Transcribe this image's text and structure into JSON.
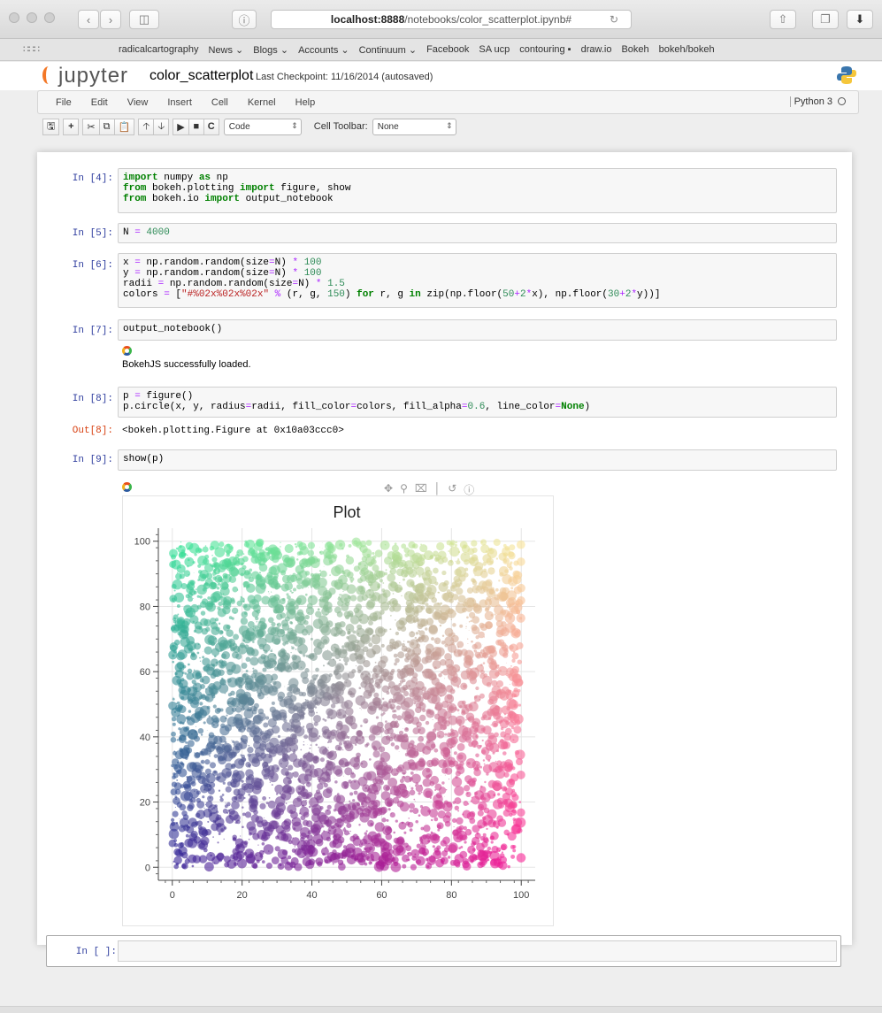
{
  "browser": {
    "url_host": "localhost:8888",
    "url_path": "/notebooks/color_scatterplot.ipynb#",
    "bookmarks": [
      "radicalcartography",
      "News ⌄",
      "Blogs ⌄",
      "Accounts ⌄",
      "Continuum ⌄",
      "Facebook",
      "SA ucp",
      "contouring ▪",
      "draw.io",
      "Bokeh",
      "bokeh/bokeh"
    ]
  },
  "jupyter": {
    "logo": "jupyter",
    "notebook_name": "color_scatterplot",
    "checkpoint": "Last Checkpoint: 11/16/2014 (autosaved)",
    "kernel": "Python 3",
    "menu": [
      "File",
      "Edit",
      "View",
      "Insert",
      "Cell",
      "Kernel",
      "Help"
    ],
    "cell_type": "Code",
    "cell_toolbar_label": "Cell Toolbar:",
    "cell_toolbar_value": "None"
  },
  "cells": {
    "c4": {
      "prompt": "In [4]:"
    },
    "c5": {
      "prompt": "In [5]:"
    },
    "c6": {
      "prompt": "In [6]:"
    },
    "c7": {
      "prompt": "In [7]:",
      "output": "BokehJS successfully loaded."
    },
    "c8": {
      "prompt": "In [8]:",
      "out_prompt": "Out[8]:",
      "output": "<bokeh.plotting.Figure at 0x10a03ccc0>"
    },
    "c9": {
      "prompt": "In [9]:"
    },
    "empty": {
      "prompt": "In [ ]:"
    }
  },
  "chart_data": {
    "type": "scatter",
    "title": "Plot",
    "xlabel": "",
    "ylabel": "",
    "xlim": [
      -4,
      104
    ],
    "ylim": [
      -4,
      104
    ],
    "xticks": [
      0,
      20,
      40,
      60,
      80,
      100
    ],
    "yticks": [
      0,
      20,
      40,
      60,
      80,
      100
    ],
    "n_points": 4000,
    "x_range": [
      0,
      100
    ],
    "y_range": [
      0,
      100
    ],
    "radius_range": [
      0,
      1.5
    ],
    "fill_alpha": 0.6,
    "color_rule": "r = floor(50 + 2*x), g = floor(30 + 2*y), b = 150",
    "grid": true,
    "legend": "none",
    "toolbar": "top-right"
  }
}
